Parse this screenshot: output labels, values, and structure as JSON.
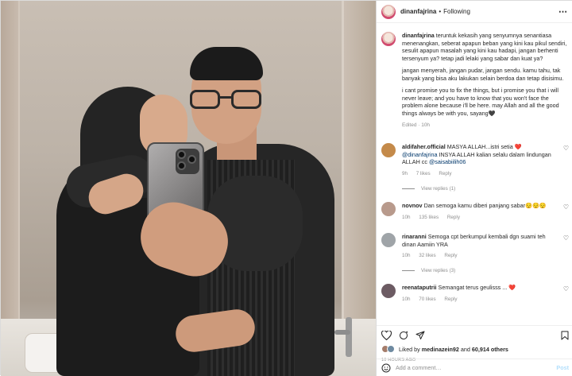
{
  "post": {
    "username": "dinanfajrina",
    "separator": "•",
    "follow_status": "Following",
    "caption": {
      "p1": "teruntuk kekasih yang senyumnya senantiasa menenangkan, seberat apapun beban yang kini kau pikul sendiri, sesulit apapun masalah yang kini kau hadapi, jangan berhenti tersenyum ya? tetap jadi lelaki yang sabar dan kuat ya?",
      "p2": "jangan menyerah, jangan pudar, jangan sendu. kamu tahu, tak banyak yang bisa aku lakukan selain berdoa dan tetap disisimu.",
      "p3": "i cant promise you to fix the things, but i promise you that i will never leave; and you have to know that you won't face the problem alone because i'll be here. may Allah and all the good things always be with you, sayang🖤",
      "meta": "Edited · 10h"
    }
  },
  "comments": [
    {
      "username": "aldifaher.official",
      "text_a": "MASYA ALLAH...istri setia ",
      "heart": "❤️",
      "mention1": "@dinanfajrina",
      "text_b": " INSYA ALLAH kalian selalu dalam lindungan ALLAH cc ",
      "mention2": "@saisabiilih06",
      "time": "9h",
      "likes": "7 likes",
      "reply": "Reply",
      "replies": "View replies (1)",
      "avatar_color": "#c48a4a"
    },
    {
      "username": "novnov",
      "text": "Dan semoga kamu diberi panjang sabar😌😌😌",
      "time": "10h",
      "likes": "135 likes",
      "reply": "Reply",
      "avatar_color": "#b89a8c"
    },
    {
      "username": "rinaranni",
      "text": "Semoga cpt berkumpul kembali dgn suami teh dinan Aamiin YRA",
      "time": "10h",
      "likes": "32 likes",
      "reply": "Reply",
      "replies": "View replies (3)",
      "avatar_color": "#9fa4a8"
    },
    {
      "username": "reenataputrii",
      "text": "Semangat terus geulisss ... ",
      "heart": "❤️",
      "time": "10h",
      "likes": "70 likes",
      "reply": "Reply",
      "avatar_color": "#6c5b63"
    }
  ],
  "actions": {
    "liked_by_prefix": "Liked by ",
    "liked_by_user": "medinazein92",
    "liked_by_mid": " and ",
    "liked_by_others": "60,914 others",
    "time_ago": "10 HOURS AGO"
  },
  "add_comment": {
    "placeholder": "Add a comment…",
    "post_label": "Post"
  },
  "colors": {
    "accent_link": "#00376b",
    "post_button": "#b2dffc",
    "muted": "#8e8e8e"
  }
}
